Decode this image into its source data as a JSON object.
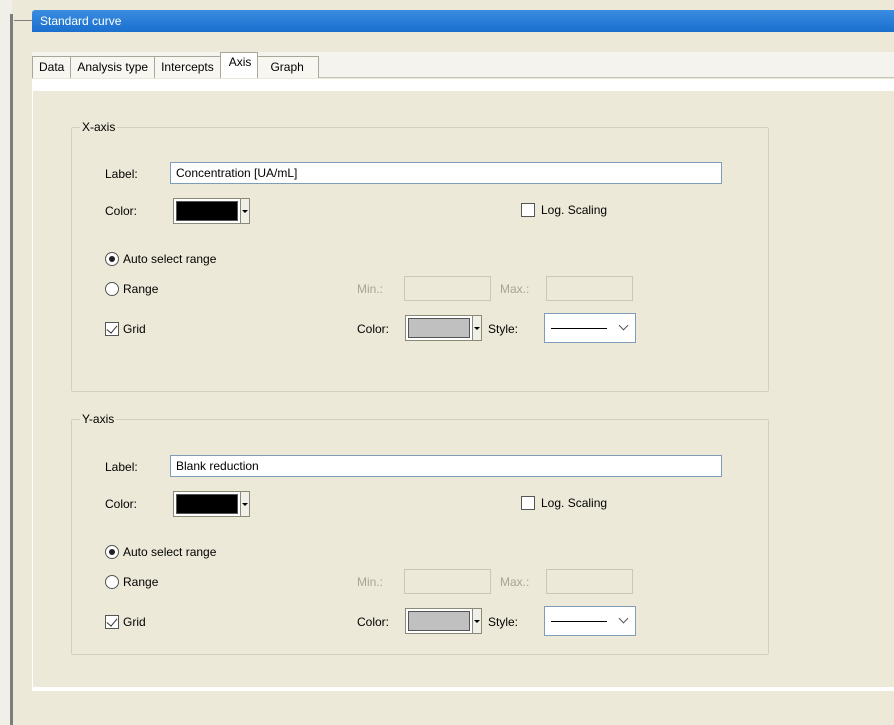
{
  "window": {
    "title": "Standard curve"
  },
  "tabs": [
    {
      "label": "Data"
    },
    {
      "label": "Analysis type"
    },
    {
      "label": "Intercepts"
    },
    {
      "label": "Axis",
      "active": true
    },
    {
      "label": "Graph"
    }
  ],
  "x_axis": {
    "group_title": "X-axis",
    "label_caption": "Label:",
    "label_value": "Concentration [UA/mL]",
    "color_caption": "Color:",
    "color_value": "#000000",
    "log_scaling": {
      "label": "Log. Scaling",
      "checked": false
    },
    "auto_select_range": {
      "label": "Auto select range",
      "selected": true
    },
    "range": {
      "label": "Range",
      "selected": false
    },
    "min_caption": "Min.:",
    "min_value": "",
    "max_caption": "Max.:",
    "max_value": "",
    "grid": {
      "label": "Grid",
      "checked": true
    },
    "grid_color_caption": "Color:",
    "grid_color_value": "#c0c0c0",
    "style_caption": "Style:"
  },
  "y_axis": {
    "group_title": "Y-axis",
    "label_caption": "Label:",
    "label_value": "Blank reduction",
    "color_caption": "Color:",
    "color_value": "#000000",
    "log_scaling": {
      "label": "Log. Scaling",
      "checked": false
    },
    "auto_select_range": {
      "label": "Auto select range",
      "selected": true
    },
    "range": {
      "label": "Range",
      "selected": false
    },
    "min_caption": "Min.:",
    "min_value": "",
    "max_caption": "Max.:",
    "max_value": "",
    "grid": {
      "label": "Grid",
      "checked": true
    },
    "grid_color_caption": "Color:",
    "grid_color_value": "#c0c0c0",
    "style_caption": "Style:"
  }
}
